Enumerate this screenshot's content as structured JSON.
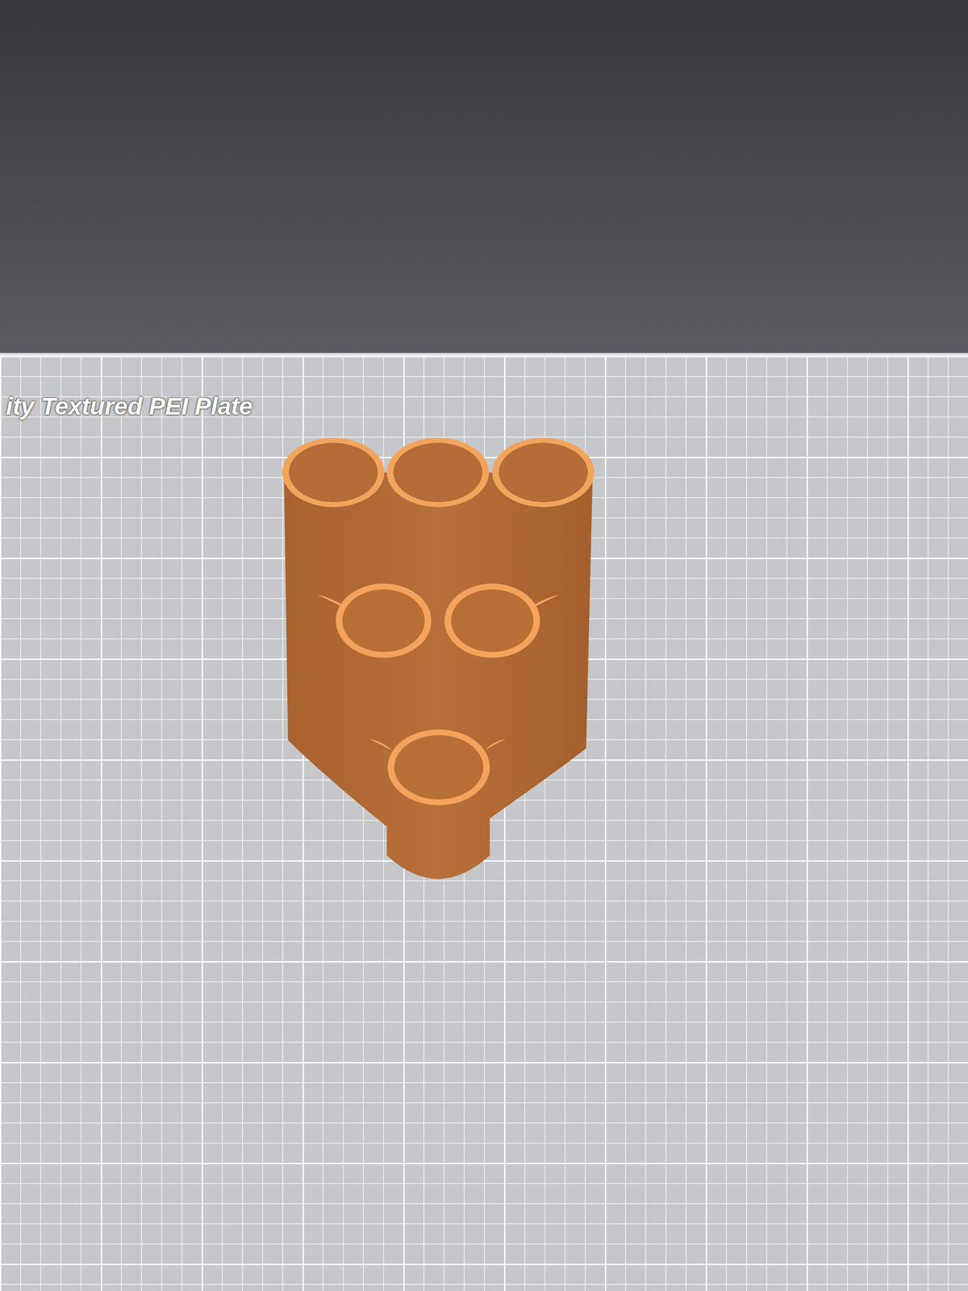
{
  "plate": {
    "label": "ity Textured PEI Plate"
  }
}
